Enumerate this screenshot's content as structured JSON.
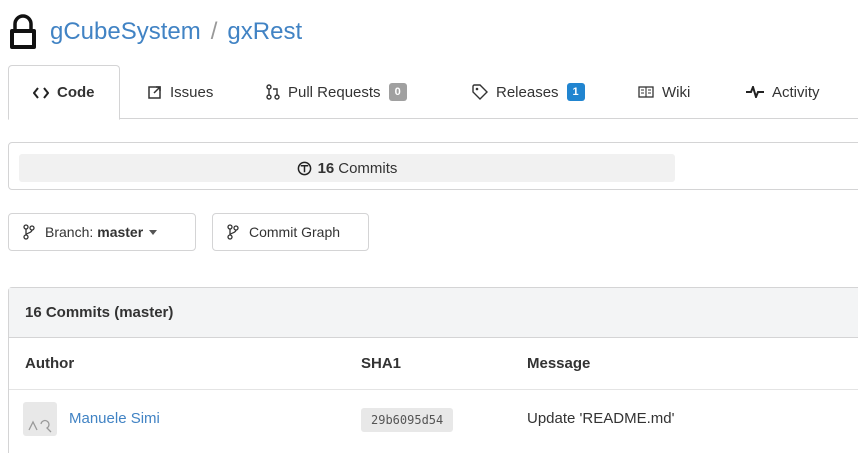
{
  "repo": {
    "owner": "gCubeSystem",
    "separator": "/",
    "name": "gxRest"
  },
  "tabs": [
    {
      "label": "Code",
      "icon": "code-icon",
      "active": true
    },
    {
      "label": "Issues",
      "icon": "issue-icon"
    },
    {
      "label": "Pull Requests",
      "icon": "pull-request-icon",
      "badge": "0"
    },
    {
      "label": "Releases",
      "icon": "tag-icon",
      "badge": "1"
    },
    {
      "label": "Wiki",
      "icon": "book-icon"
    },
    {
      "label": "Activity",
      "icon": "pulse-icon"
    }
  ],
  "commits_bar": {
    "count": "16",
    "label": "Commits"
  },
  "branch_button": {
    "label": "Branch:",
    "value": "master"
  },
  "graph_button": {
    "label": "Commit Graph"
  },
  "commits_table": {
    "title": "16 Commits (master)",
    "columns": [
      "Author",
      "SHA1",
      "Message"
    ],
    "rows": [
      {
        "author": "Manuele Simi",
        "sha": "29b6095d54",
        "message": "Update 'README.md'"
      }
    ]
  },
  "colors": {
    "link": "#4183c4",
    "badge_blue": "#2185d0",
    "badge_grey": "#a0a0a0"
  }
}
